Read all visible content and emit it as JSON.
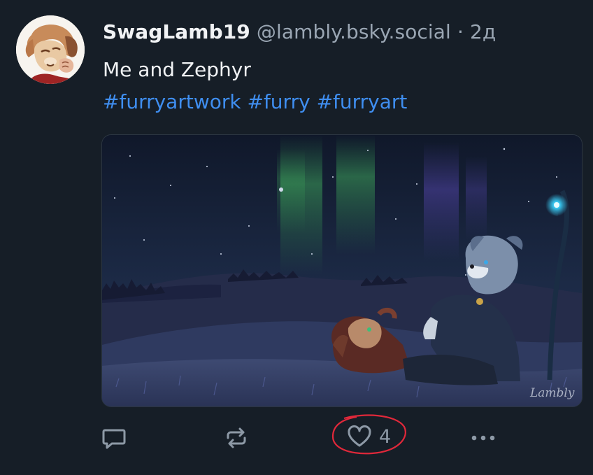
{
  "post": {
    "display_name": "SwagLamb19",
    "handle": "@lambly.bsky.social",
    "separator": "·",
    "time": "2д",
    "text": "Me and Zephyr",
    "hashtags": [
      "#furryartwork",
      "#furry",
      "#furryart"
    ],
    "image": {
      "signature": "Lambly"
    }
  },
  "actions": {
    "reply_icon": "speech-bubble-icon",
    "repost_icon": "repost-arrows-icon",
    "like_icon": "heart-outline-icon",
    "like_count": "4",
    "more_icon": "more-dots-icon",
    "highlight_color": "#e0283a"
  },
  "colors": {
    "background": "#161e27",
    "text": "#f1f3f5",
    "muted": "#9aa6b3",
    "link": "#3f8ef0"
  }
}
